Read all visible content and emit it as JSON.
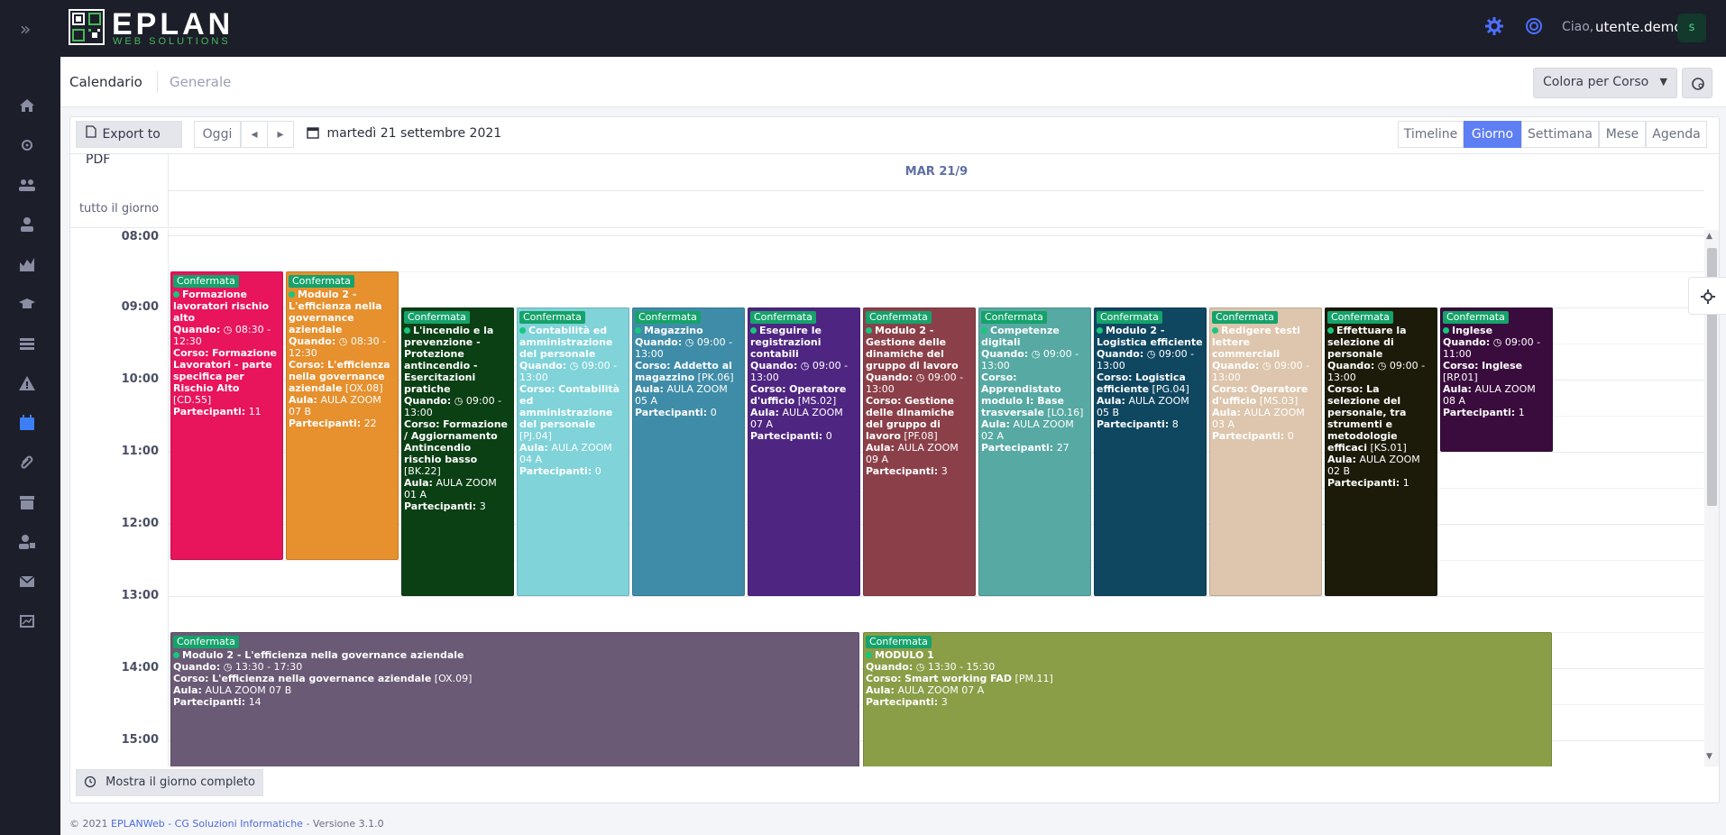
{
  "app": {
    "brand": "EPLAN",
    "brand_sub": "WEB SOLUTIONS",
    "greeting": "Ciao,",
    "username": "utente.demo",
    "avatar_letter": "s"
  },
  "header": {
    "title": "Calendario",
    "subtitle": "Generale",
    "color_select": "Colora per Corso"
  },
  "toolbar": {
    "export_pdf": "Export to PDF",
    "today": "Oggi",
    "prev": "◂",
    "next": "▸",
    "date": "martedì 21 settembre 2021",
    "views": [
      "Timeline",
      "Giorno",
      "Settimana",
      "Mese",
      "Agenda"
    ],
    "active_view": "Giorno"
  },
  "calendar": {
    "day_header": "MAR 21/9",
    "allday_label": "tutto il giorno",
    "hours": [
      "08:00",
      "09:00",
      "10:00",
      "11:00",
      "12:00",
      "13:00",
      "14:00",
      "15:00"
    ],
    "show_full_day": "Mostra il giorno completo",
    "labels": {
      "status": "Confermata",
      "when": "Quando:",
      "course": "Corso:",
      "room": "Aula:",
      "participants": "Partecipanti:"
    },
    "events": [
      {
        "title": "Formazione lavoratori rischio alto",
        "time": "08:30 - 12:30",
        "course": "Formazione Lavoratori - parte specifica per Rischio Alto",
        "code": "[CD.55]",
        "room": "",
        "participants": "11",
        "color": "#e8145c",
        "text": "#ffffff"
      },
      {
        "title": "Modulo 2 - L'efficienza nella governance aziendale",
        "time": "08:30 - 12:30",
        "course": "L'efficienza nella governance aziendale",
        "code": "[OX.08]",
        "room": "AULA ZOOM 07 B",
        "participants": "22",
        "color": "#e6902e",
        "text": "#ffffff"
      },
      {
        "title": "L'incendio e la prevenzione - Protezione antincendio - Esercitazioni pratiche",
        "time": "09:00 - 13:00",
        "course": "Formazione / Aggiornamento Antincendio rischio basso",
        "code": "[BK.22]",
        "room": "AULA ZOOM 01 A",
        "participants": "3",
        "color": "#0b3f14",
        "text": "#ffffff"
      },
      {
        "title": "Contabilità ed amministrazione del personale",
        "time": "09:00 - 13:00",
        "course": "Contabilità ed amministrazione del personale",
        "code": "[PJ.04]",
        "room": "AULA ZOOM 04 A",
        "participants": "0",
        "color": "#7fd3d9",
        "text": "#ffffff"
      },
      {
        "title": "Magazzino",
        "time": "09:00 - 13:00",
        "course": "Addetto al magazzino",
        "code": "[PK.06]",
        "room": "AULA ZOOM 05 A",
        "participants": "0",
        "color": "#3f8ca8",
        "text": "#ffffff"
      },
      {
        "title": "Eseguire le registrazioni contabili",
        "time": "09:00 - 13:00",
        "course": "Operatore d'ufficio",
        "code": "[MS.02]",
        "room": "AULA ZOOM 07 A",
        "participants": "0",
        "color": "#4f2582",
        "text": "#ffffff"
      },
      {
        "title": "Modulo 2 - Gestione delle dinamiche del gruppo di lavoro",
        "time": "09:00 - 13:00",
        "course": "Gestione delle dinamiche del gruppo di lavoro",
        "code": "[PF.08]",
        "room": "AULA ZOOM 09 A",
        "participants": "3",
        "color": "#8b4049",
        "text": "#ffffff"
      },
      {
        "title": "Competenze digitali",
        "time": "09:00 - 13:00",
        "course": "Apprendistato modulo I: Base trasversale",
        "code": "[LO.16]",
        "room": "AULA ZOOM 02 A",
        "participants": "27",
        "color": "#57a9a3",
        "text": "#ffffff"
      },
      {
        "title": "Modulo 2 - Logistica efficiente",
        "time": "09:00 - 13:00",
        "course": "Logistica efficiente",
        "code": "[PG.04]",
        "room": "AULA ZOOM 05 B",
        "participants": "8",
        "color": "#0f4761",
        "text": "#ffffff"
      },
      {
        "title": "Redigere testi lettere commerciali",
        "time": "09:00 - 13:00",
        "course": "Operatore d'ufficio",
        "code": "[MS.03]",
        "room": "AULA ZOOM 03 A",
        "participants": "0",
        "color": "#ddc6ad",
        "text": "#ffffff"
      },
      {
        "title": "Effettuare la selezione di personale",
        "time": "09:00 - 13:00",
        "course": "La selezione del personale, tra strumenti e metodologie efficaci",
        "code": "[KS.01]",
        "room": "AULA ZOOM 02 B",
        "participants": "1",
        "color": "#1c1a08",
        "text": "#ffffff"
      },
      {
        "title": "Inglese",
        "time": "09:00 - 11:00",
        "course": "Inglese",
        "code": "[RP.01]",
        "room": "AULA ZOOM 08 A",
        "participants": "1",
        "color": "#3a0c3e",
        "text": "#ffffff"
      },
      {
        "title": "Modulo 2 - L'efficienza nella governance aziendale",
        "time": "13:30 - 17:30",
        "course": "L'efficienza nella governance aziendale",
        "code": "[OX.09]",
        "room": "AULA ZOOM 07 B",
        "participants": "14",
        "color": "#6a5a75",
        "text": "#ffffff"
      },
      {
        "title": "MODULO 1",
        "time": "13:30 - 15:30",
        "course": "Smart working FAD",
        "code": "[PM.11]",
        "room": "AULA ZOOM 07 A",
        "participants": "3",
        "color": "#8a9e47",
        "text": "#ffffff"
      }
    ]
  },
  "footer": {
    "copyright": "© 2021",
    "link": "EPLANWeb - CG Soluzioni Informatiche",
    "version": "- Versione 3.1.0"
  },
  "colors": {
    "accent": "#5e7ef4",
    "topbar": "#1c1e2a",
    "badge": "#16a26b"
  }
}
